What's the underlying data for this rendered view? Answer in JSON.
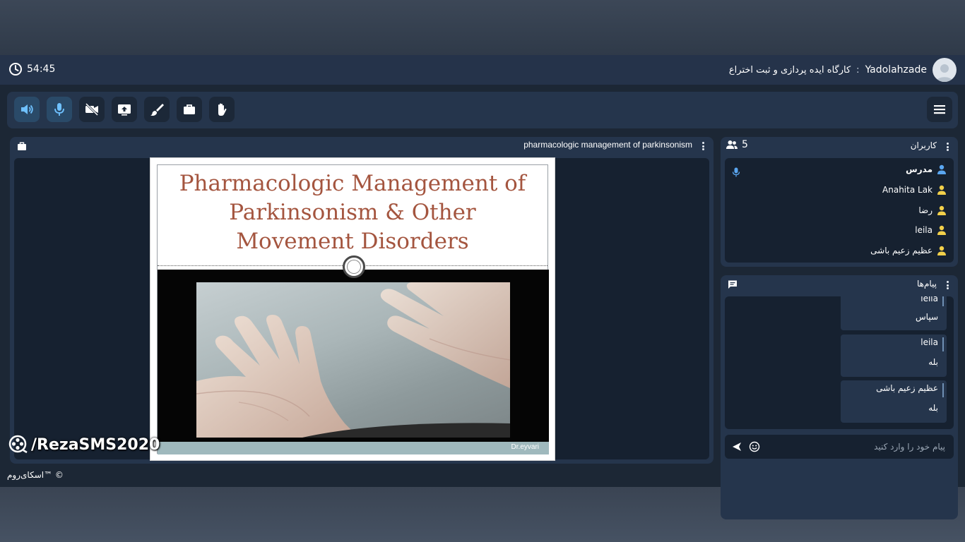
{
  "header": {
    "timer": "54:45",
    "user_name": "Yadolahzade",
    "separator": ":",
    "room_title": "کارگاه ایده پردازی و ثبت اختراع"
  },
  "toolbar": {
    "buttons": [
      {
        "name": "speaker-button",
        "icon": "speaker-icon"
      },
      {
        "name": "microphone-button",
        "icon": "microphone-icon"
      },
      {
        "name": "camera-button",
        "icon": "camera-off-icon"
      },
      {
        "name": "share-screen-button",
        "icon": "share-screen-icon"
      },
      {
        "name": "whiteboard-button",
        "icon": "brush-icon"
      },
      {
        "name": "files-button",
        "icon": "briefcase-icon"
      },
      {
        "name": "raise-hand-button",
        "icon": "hand-icon"
      }
    ],
    "menu_icon": "hamburger-icon"
  },
  "presentation": {
    "title": "pharmacologic management of parkinsonism",
    "slide": {
      "title_lines": [
        "Pharmacologic Management of",
        "Parkinsonism & Other",
        "Movement Disorders"
      ],
      "credit": "Dr.eyvari"
    }
  },
  "watermark": {
    "text": "/RezaSMS2020"
  },
  "users": {
    "title": "کاربران",
    "count": "5",
    "list": [
      {
        "name": "مدرس",
        "role": "presenter",
        "color": "#5aa6f0"
      },
      {
        "name": "Anahita Lak",
        "role": "viewer",
        "color": "#f2d04a"
      },
      {
        "name": "رضا",
        "role": "viewer",
        "color": "#f2d04a"
      },
      {
        "name": "leila",
        "role": "viewer",
        "color": "#f2d04a"
      },
      {
        "name": "عظیم زعیم باشی",
        "role": "viewer",
        "color": "#f2d04a"
      }
    ]
  },
  "messages": {
    "title": "پیام‌ها",
    "items": [
      {
        "author": "leila",
        "text": "سپاس"
      },
      {
        "author": "leila",
        "text": "بله"
      },
      {
        "author": "عظیم زعیم باشی",
        "text": "بله"
      }
    ],
    "input_placeholder": "پیام خود را وارد کنید"
  },
  "footer": {
    "brand": "اسکای‌روم™ ©"
  },
  "colors": {
    "accent": "#5aa6f0",
    "panel": "#25354c",
    "panel_body": "#162130",
    "slide_title": "#a4553f"
  }
}
